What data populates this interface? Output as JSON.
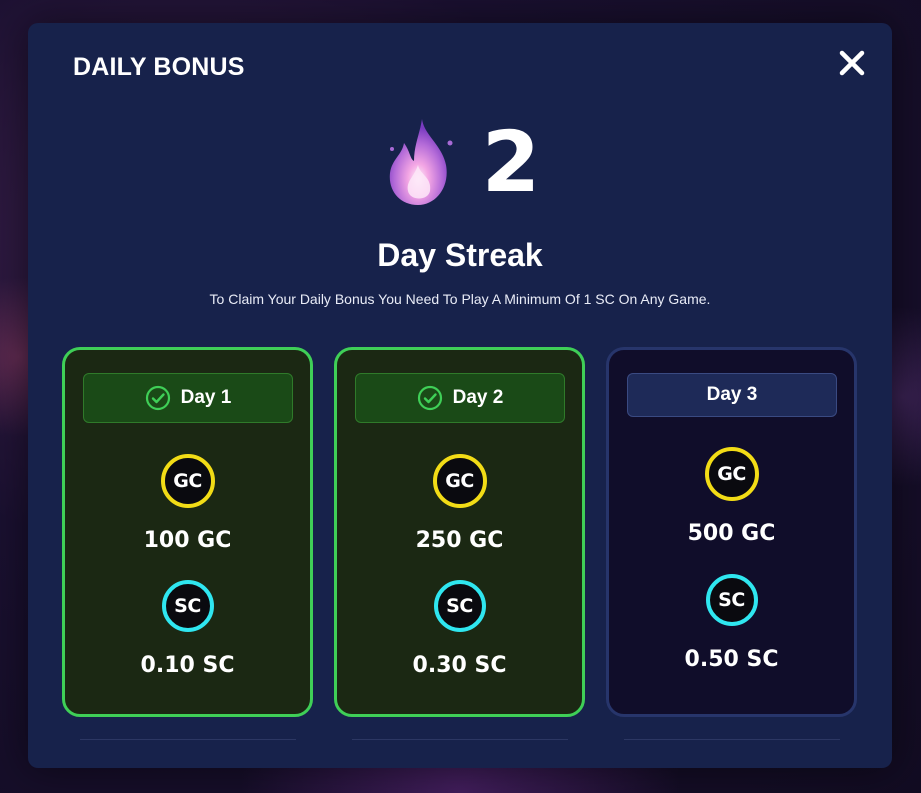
{
  "modal": {
    "title": "DAILY BONUS",
    "close_icon": "close-icon"
  },
  "streak": {
    "icon": "flame-icon",
    "count": "2",
    "label": "Day Streak",
    "note": "To Claim Your Daily Bonus You Need To Play A Minimum Of 1 SC On Any Game."
  },
  "days": [
    {
      "label": "Day 1",
      "status": "claimed",
      "gc_badge": "GC",
      "gc_amount": "100 GC",
      "sc_badge": "SC",
      "sc_amount": "0.10 SC"
    },
    {
      "label": "Day 2",
      "status": "claimed",
      "gc_badge": "GC",
      "gc_amount": "250 GC",
      "sc_badge": "SC",
      "sc_amount": "0.30 SC"
    },
    {
      "label": "Day 3",
      "status": "locked",
      "gc_badge": "GC",
      "gc_amount": "500 GC",
      "sc_badge": "SC",
      "sc_amount": "0.50 SC"
    }
  ],
  "colors": {
    "modal_bg": "#17224b",
    "claimed_border": "#3fcf57",
    "locked_border": "#27356b",
    "gc_ring": "#f2dc16",
    "sc_ring": "#2fe6f0"
  }
}
